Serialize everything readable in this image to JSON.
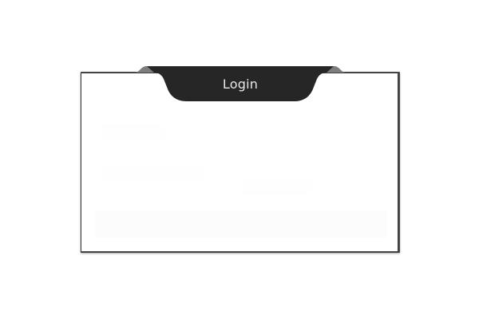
{
  "dialog": {
    "title": "Login"
  },
  "colors": {
    "page_background": "#ffffff",
    "card_background": "#ffffff",
    "header_background": "#262626",
    "header_text": "#e8e8e8",
    "border": "#3f3f3f"
  },
  "icons": {
    "header_tab_shape": "login-tab-shape-icon"
  }
}
